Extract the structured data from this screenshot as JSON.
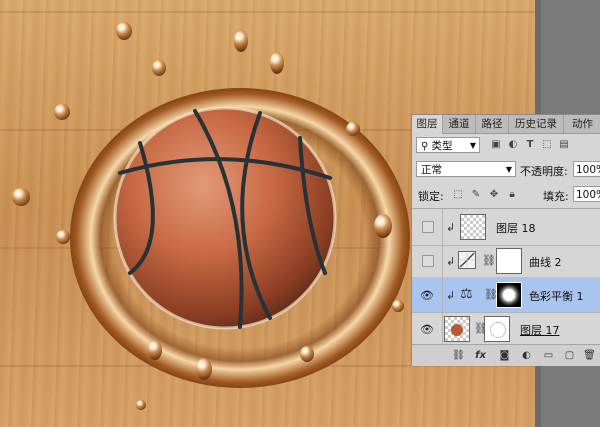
{
  "layers_panel": {
    "tabs": [
      "图层",
      "通道",
      "路径",
      "历史记录",
      "动作"
    ],
    "filter_kind": "类型",
    "blend_mode": "正常",
    "opacity_label": "不透明度:",
    "opacity_value": "100%",
    "lock_label": "锁定:",
    "fill_label": "填充:",
    "fill_value": "100%",
    "layers": [
      {
        "name": "图层 18",
        "visible": false,
        "selected": false,
        "type": "pixel"
      },
      {
        "name": "曲线 2",
        "visible": false,
        "selected": false,
        "type": "curves"
      },
      {
        "name": "色彩平衡 1",
        "visible": true,
        "selected": true,
        "type": "color-balance"
      },
      {
        "name": "图层 17",
        "visible": true,
        "selected": false,
        "type": "pixel-masked"
      }
    ],
    "bottom_icons": [
      "link-icon",
      "fx-icon",
      "add-mask-icon",
      "adjustment-icon",
      "folder-icon",
      "new-layer-icon",
      "trash-icon"
    ]
  },
  "colors": {
    "selected_row": "#a9c4ee",
    "panel_bg": "#d6d6d6",
    "wood": "#c98f52"
  }
}
